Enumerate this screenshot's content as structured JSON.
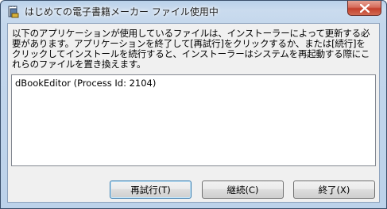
{
  "window": {
    "title": "はじめての電子書籍メーカー ファイル使用中"
  },
  "icons": {
    "app": "installer-app-icon",
    "close": "close-icon"
  },
  "message": "以下のアプリケーションが使用しているファイルは、インストーラーによって更新する必要があります。アプリケーションを終了して[再試行]をクリックするか、または[続行]をクリックしてインストールを続行すると、インストーラーはシステムを再起動する際にこれらのファイルを置き換えます。",
  "process_list": [
    "dBookEditor (Process Id: 2104)"
  ],
  "buttons": {
    "retry": "再試行(T)",
    "continue": "継続(C)",
    "exit": "終了(X)"
  }
}
